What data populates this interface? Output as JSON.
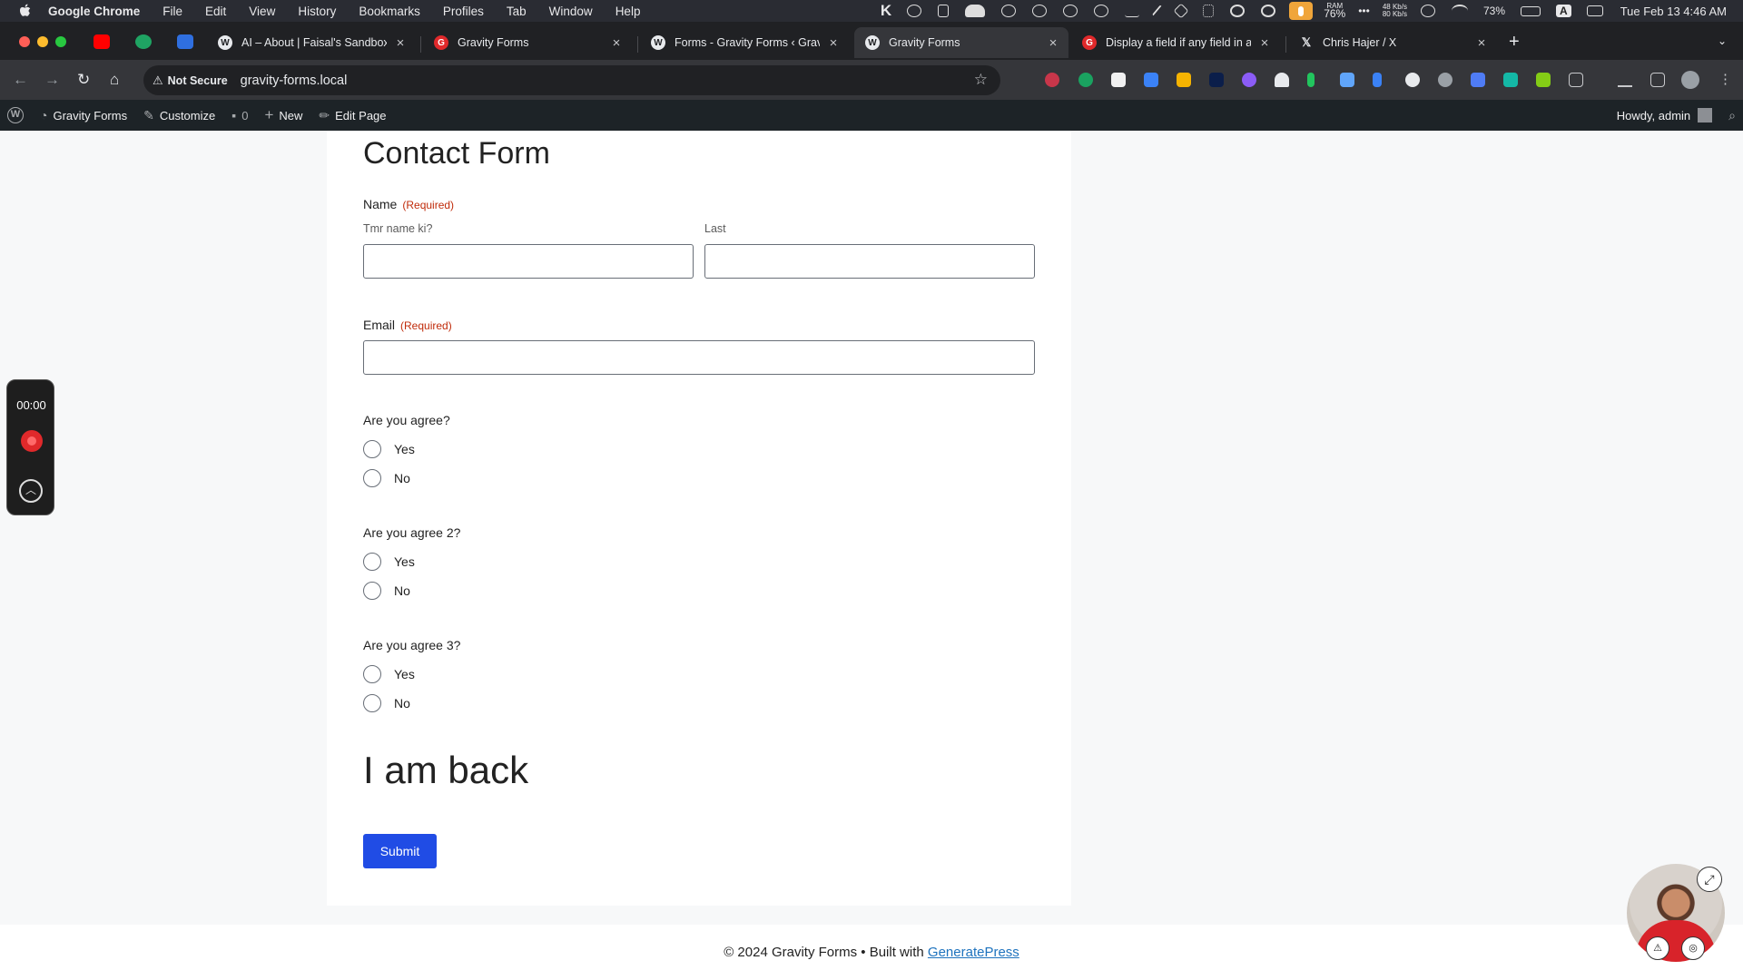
{
  "menubar": {
    "app_name": "Google Chrome",
    "items": [
      "File",
      "Edit",
      "View",
      "History",
      "Bookmarks",
      "Profiles",
      "Tab",
      "Window",
      "Help"
    ],
    "ram_label": "RAM",
    "ram_value": "76%",
    "net_up": "48 Kb/s",
    "net_down": "80 Kb/s",
    "battery": "73%",
    "input_source": "A",
    "datetime": "Tue Feb 13  4:46 AM"
  },
  "tabs": [
    {
      "label": "AI – About | Faisal's Sandbox",
      "favicon": "wordpress-icon"
    },
    {
      "label": "Gravity Forms",
      "favicon": "gravity-forms-icon"
    },
    {
      "label": "Forms - Gravity Forms ‹ Grav",
      "favicon": "wordpress-icon"
    },
    {
      "label": "Gravity Forms",
      "favicon": "wordpress-icon",
      "active": true
    },
    {
      "label": "Display a field if any field in a",
      "favicon": "gravity-forms-icon"
    },
    {
      "label": "Chris Hajer / X",
      "favicon": "x-icon"
    }
  ],
  "address": {
    "security_label": "Not Secure",
    "url": "gravity-forms.local"
  },
  "adminbar": {
    "site_name": "Gravity Forms",
    "customize": "Customize",
    "comments_count": "0",
    "new": "New",
    "edit_page": "Edit Page",
    "greeting": "Howdy, admin"
  },
  "form": {
    "title": "Contact Form",
    "name_label": "Name",
    "required_text": "(Required)",
    "first_sublabel": "Tmr name ki?",
    "last_sublabel": "Last",
    "email_label": "Email",
    "questions": [
      {
        "label": "Are you agree?",
        "options": [
          "Yes",
          "No"
        ]
      },
      {
        "label": "Are you agree 2?",
        "options": [
          "Yes",
          "No"
        ]
      },
      {
        "label": "Are you agree 3?",
        "options": [
          "Yes",
          "No"
        ]
      }
    ],
    "html_block": "I am back",
    "submit_label": "Submit"
  },
  "footer": {
    "text": "© 2024 Gravity Forms • Built with ",
    "link": "GeneratePress"
  },
  "recorder": {
    "time": "00:00"
  },
  "colors": {
    "submit_bg": "#204ce5",
    "required": "#c02b0a",
    "adminbar_bg": "#1d2327"
  }
}
